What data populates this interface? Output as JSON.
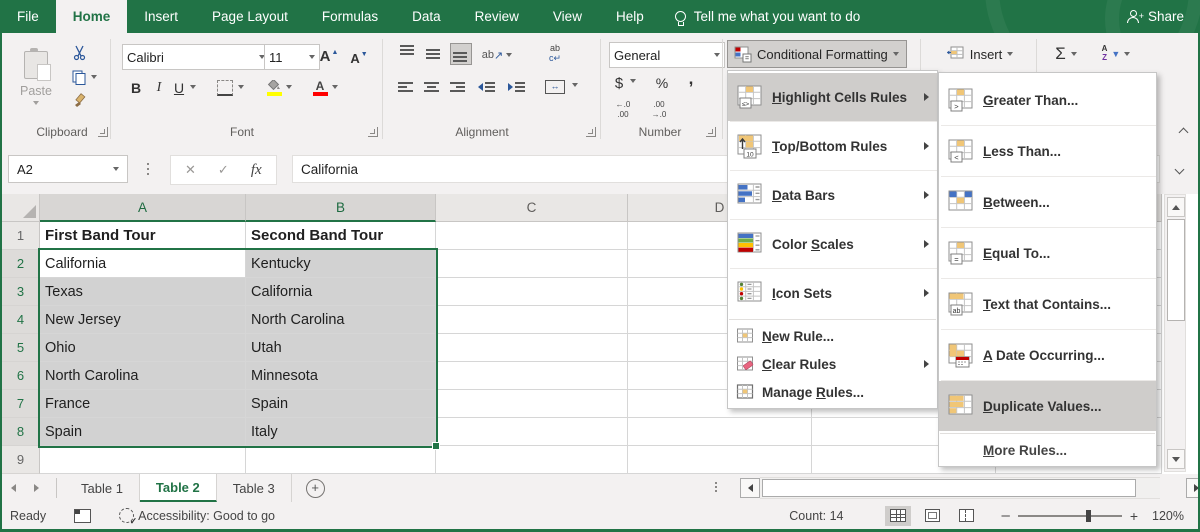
{
  "app": {
    "tabs": [
      "File",
      "Home",
      "Insert",
      "Page Layout",
      "Formulas",
      "Data",
      "Review",
      "View",
      "Help"
    ],
    "active_tab": "Home",
    "tell_me": "Tell me what you want to do",
    "share": "Share"
  },
  "ribbon": {
    "clipboard": {
      "label": "Clipboard",
      "paste": "Paste"
    },
    "font": {
      "label": "Font",
      "font_name": "Calibri",
      "font_size": "11",
      "bold": "B",
      "italic": "I",
      "underline": "U",
      "grow": "A",
      "shrink": "A",
      "color_letter": "A"
    },
    "alignment": {
      "label": "Alignment",
      "orientation": "ab",
      "wrap_top": "ab",
      "wrap_bottom": "c↵",
      "merge_arrow": "↔"
    },
    "number": {
      "label": "Number",
      "format": "General",
      "currency": "$",
      "percent": "%",
      "comma": ",",
      "inc_dec_top": "←.0",
      "inc_dec_bot": ".00",
      "dec_dec_top": ".00",
      "dec_dec_bot": "→.0"
    },
    "styles": {
      "conditional_formatting": "Conditional Formatting",
      "insert": "Insert",
      "autosum": "Σ",
      "sort_a": "A",
      "sort_z": "Z"
    }
  },
  "formula_bar": {
    "name_box": "A2",
    "fx": "fx",
    "cancel": "✕",
    "enter": "✓",
    "value": "California"
  },
  "grid": {
    "columns": [
      "A",
      "B",
      "C",
      "D"
    ],
    "selected_range": "A2:B8",
    "rows": [
      {
        "n": "1",
        "a": "First Band Tour",
        "b": "Second Band Tour"
      },
      {
        "n": "2",
        "a": "California",
        "b": "Kentucky"
      },
      {
        "n": "3",
        "a": "Texas",
        "b": "California"
      },
      {
        "n": "4",
        "a": "New Jersey",
        "b": "North Carolina"
      },
      {
        "n": "5",
        "a": "Ohio",
        "b": "Utah"
      },
      {
        "n": "6",
        "a": "North Carolina",
        "b": "Minnesota"
      },
      {
        "n": "7",
        "a": "France",
        "b": "Spain"
      },
      {
        "n": "8",
        "a": "Spain",
        "b": "Italy"
      },
      {
        "n": "9",
        "a": "",
        "b": ""
      }
    ]
  },
  "cf_menu": {
    "items": [
      {
        "pre": "",
        "u": "H",
        "rest": "ighlight Cells Rules",
        "icon": "highlight-cells-rules-icon",
        "submenu": true,
        "highlighted": true
      },
      {
        "pre": "",
        "u": "T",
        "rest": "op/Bottom Rules",
        "icon": "top-bottom-rules-icon",
        "submenu": true
      },
      {
        "pre": "",
        "u": "D",
        "rest": "ata Bars",
        "icon": "data-bars-icon",
        "submenu": true
      },
      {
        "pre": "Color ",
        "u": "S",
        "rest": "cales",
        "icon": "color-scales-icon",
        "submenu": true
      },
      {
        "pre": "",
        "u": "I",
        "rest": "con Sets",
        "icon": "icon-sets-icon",
        "submenu": true
      }
    ],
    "small_items": [
      {
        "pre": "",
        "u": "N",
        "rest": "ew Rule...",
        "icon": "new-rule-icon"
      },
      {
        "pre": "",
        "u": "C",
        "rest": "lear Rules",
        "icon": "clear-rules-icon",
        "submenu": true
      },
      {
        "pre": "Manage ",
        "u": "R",
        "rest": "ules...",
        "icon": "manage-rules-icon"
      }
    ]
  },
  "cf_submenu": {
    "items": [
      {
        "pre": "",
        "u": "G",
        "rest": "reater Than...",
        "icon": "greater-than-icon"
      },
      {
        "pre": "",
        "u": "L",
        "rest": "ess Than...",
        "icon": "less-than-icon"
      },
      {
        "pre": "",
        "u": "B",
        "rest": "etween...",
        "icon": "between-icon"
      },
      {
        "pre": "",
        "u": "E",
        "rest": "qual To...",
        "icon": "equal-to-icon"
      },
      {
        "pre": "",
        "u": "T",
        "rest": "ext that Contains...",
        "icon": "text-that-contains-icon"
      },
      {
        "pre": "",
        "u": "A",
        "rest": " Date Occurring...",
        "icon": "a-date-occurring-icon"
      },
      {
        "pre": "",
        "u": "D",
        "rest": "uplicate Values...",
        "icon": "duplicate-values-icon",
        "highlighted": true
      },
      {
        "pre": "",
        "u": "M",
        "rest": "ore Rules...",
        "icon": null
      }
    ]
  },
  "sheet_tabs": {
    "tabs": [
      {
        "label": "Table 1",
        "active": false
      },
      {
        "label": "Table 2",
        "active": true
      },
      {
        "label": "Table 3",
        "active": false
      }
    ]
  },
  "status_bar": {
    "ready": "Ready",
    "accessibility": "Accessibility: Good to go",
    "count": "Count: 14",
    "zoom": "120%",
    "zoom_minus": "–",
    "zoom_plus": "+"
  },
  "colors": {
    "excel_green": "#217346",
    "selection_fill": "#d2d2d2",
    "menu_highlight": "#cfcdcb",
    "fill_yellow": "#ffff00",
    "font_red": "#ff0000"
  }
}
